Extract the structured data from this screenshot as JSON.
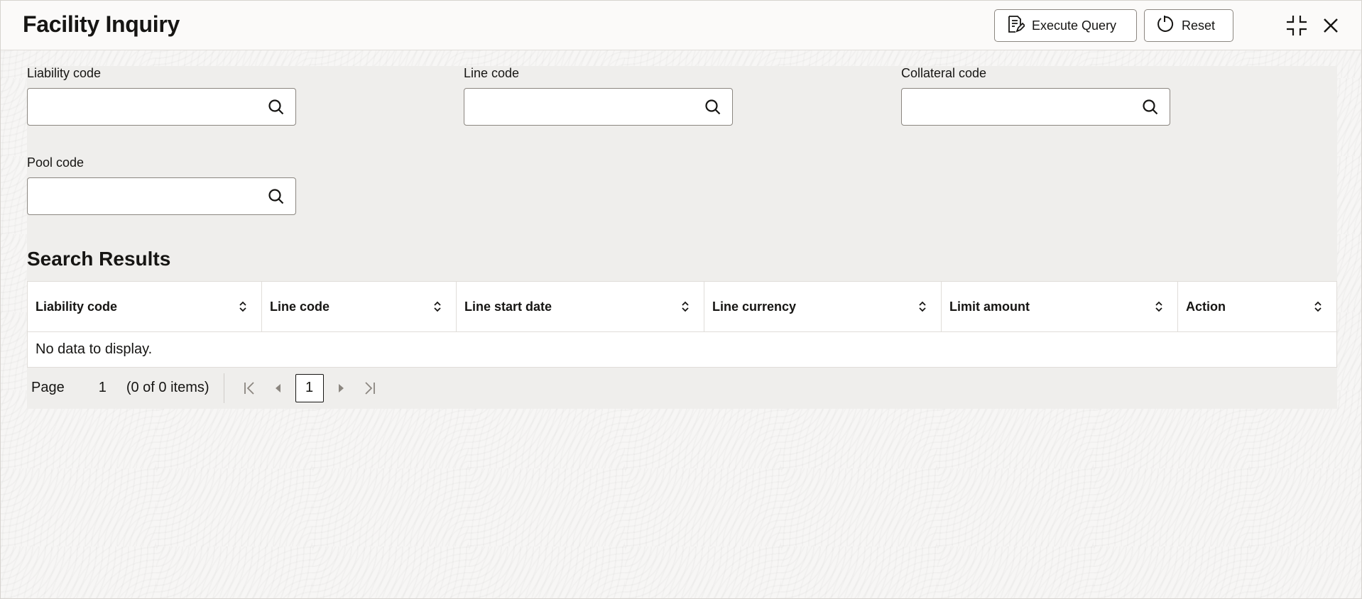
{
  "header": {
    "title": "Facility Inquiry",
    "execute_label": "Execute Query",
    "reset_label": "Reset",
    "icons": [
      "execute-query-icon",
      "reset-icon",
      "minimize-icon",
      "close-icon"
    ]
  },
  "form": {
    "liability_code": {
      "label": "Liability code",
      "value": ""
    },
    "line_code": {
      "label": "Line code",
      "value": ""
    },
    "collateral_code": {
      "label": "Collateral code",
      "value": ""
    },
    "pool_code": {
      "label": "Pool code",
      "value": ""
    }
  },
  "results": {
    "title": "Search Results",
    "columns": [
      "Liability code",
      "Line code",
      "Line start date",
      "Line currency",
      "Limit amount",
      "Action"
    ],
    "empty_message": "No data to display."
  },
  "pagination": {
    "page_label": "Page",
    "page_number": "1",
    "items_text": "(0 of 0 items)",
    "current_page": "1"
  }
}
